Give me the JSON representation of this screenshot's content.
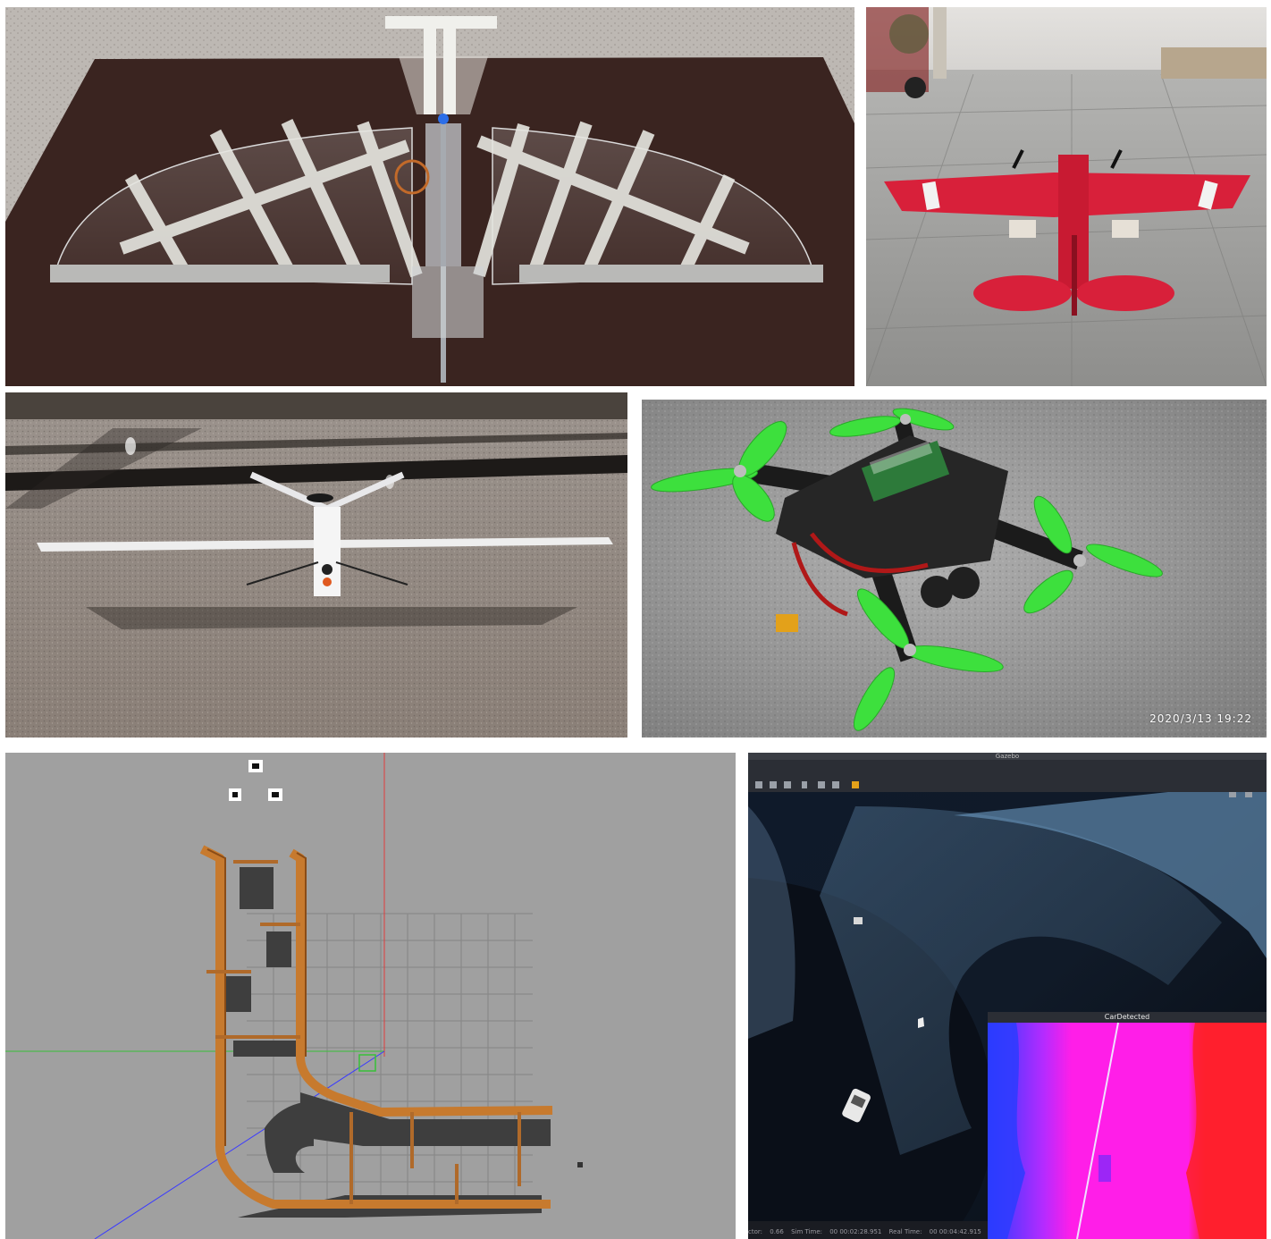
{
  "panels": [
    {
      "id": "ornithopter",
      "subject": "flapping-wing drone with transparent film wings on a table"
    },
    {
      "id": "red-plane",
      "subject": "red twin-propeller model aircraft on a rooftop"
    },
    {
      "id": "white-plane",
      "subject": "white V-tail fixed-wing drone on a polished floor"
    },
    {
      "id": "quadrotor",
      "subject": "quadrotor with green propellers and wheels"
    },
    {
      "id": "gazebo-track",
      "subject": "simulated wooden track in a gazebo-like environment"
    },
    {
      "id": "sim-screen",
      "subject": "photo of a simulator screen with a detection window"
    }
  ],
  "quadrotor": {
    "timestamp": "2020/3/13  19:22"
  },
  "sim_screen": {
    "window_title": "Gazebo",
    "inset_title": "CarDetected",
    "status_factor_label": "ctor:",
    "status_factor_value": "0.66",
    "status_sim_label": "Sim Time:",
    "status_sim_value": "00 00:02:28.951",
    "status_real_label": "Real Time:",
    "status_real_value": "00 00:04:42.915"
  },
  "colors": {
    "tabletop": "#3a2420",
    "red_plane": "#d8203a",
    "propeller_green": "#3de03d",
    "track_wood": "#c77a2e",
    "sim_background": "#a0a0a0",
    "heatmap_blue": "#2b3cff",
    "heatmap_magenta": "#ff1ee8",
    "heatmap_red": "#ff1f2e"
  }
}
